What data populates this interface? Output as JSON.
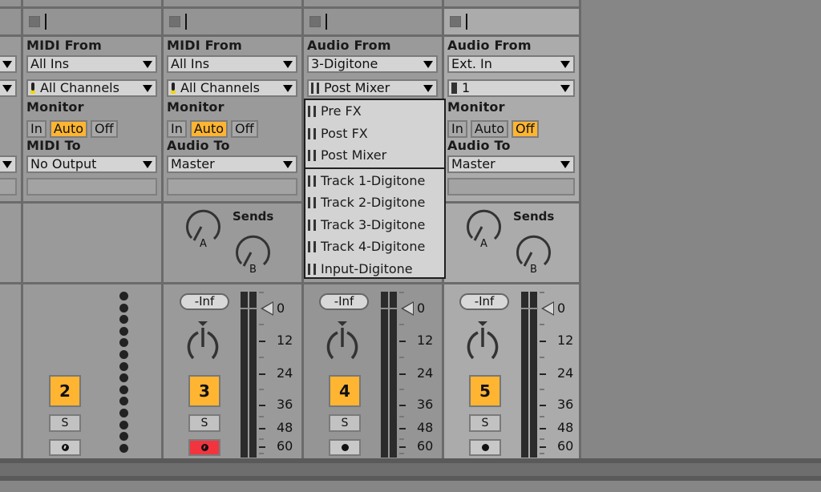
{
  "tracks": [
    {
      "id": "partial",
      "io": {
        "from_label": "",
        "from_value": "",
        "channel_value": "",
        "to_label": "",
        "to_value": ""
      }
    },
    {
      "id": "track-2",
      "io": {
        "from_label": "MIDI From",
        "from_value": "All Ins",
        "channel_value": "All Channels",
        "monitor_label": "Monitor",
        "monitor": [
          "In",
          "Auto",
          "Off"
        ],
        "monitor_active": "Auto",
        "to_label": "MIDI To",
        "to_value": "No Output"
      },
      "number": "2",
      "solo": "S",
      "arm_armed": false
    },
    {
      "id": "track-3",
      "io": {
        "from_label": "MIDI From",
        "from_value": "All Ins",
        "channel_value": "All Channels",
        "monitor_label": "Monitor",
        "monitor": [
          "In",
          "Auto",
          "Off"
        ],
        "monitor_active": "Auto",
        "to_label": "Audio To",
        "to_value": "Master"
      },
      "sends_label": "Sends",
      "send_a": "A",
      "send_b": "B",
      "volume": "-Inf",
      "number": "3",
      "solo": "S",
      "arm_armed": true
    },
    {
      "id": "track-4",
      "io": {
        "from_label": "Audio From",
        "from_value": "3-Digitone",
        "channel_value": "Post Mixer"
      },
      "volume": "-Inf",
      "number": "4",
      "solo": "S",
      "arm_armed": false
    },
    {
      "id": "track-5",
      "io": {
        "from_label": "Audio From",
        "from_value": "Ext. In",
        "channel_value": "1",
        "monitor_label": "Monitor",
        "monitor": [
          "In",
          "Auto",
          "Off"
        ],
        "monitor_active": "Off",
        "to_label": "Audio To",
        "to_value": "Master"
      },
      "sends_label": "Sends",
      "send_a": "A",
      "send_b": "B",
      "volume": "-Inf",
      "number": "5",
      "solo": "S",
      "arm_armed": false
    }
  ],
  "meter_scale": [
    "0",
    "12",
    "24",
    "36",
    "48",
    "60"
  ],
  "dropdown_menu": {
    "group1": [
      "Pre FX",
      "Post FX",
      "Post Mixer"
    ],
    "group2": [
      "Track 1-Digitone",
      "Track 2-Digitone",
      "Track 3-Digitone",
      "Track 4-Digitone",
      "Input-Digitone"
    ]
  },
  "colors": {
    "active_orange": "#ffb532",
    "arm_red": "#f2343f",
    "background": "#868686"
  }
}
